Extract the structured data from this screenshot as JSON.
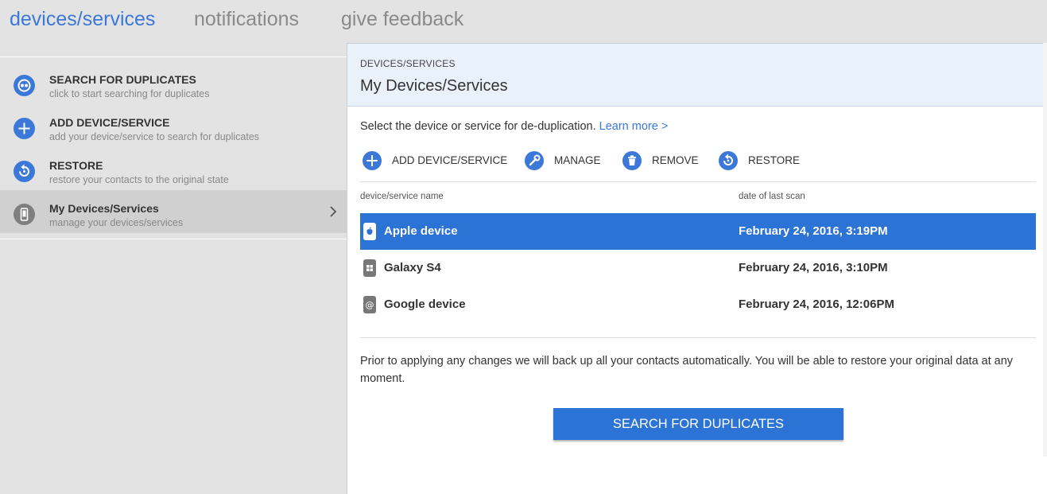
{
  "topnav": {
    "tabs": [
      {
        "label": "devices/services",
        "active": true
      },
      {
        "label": "notifications",
        "active": false
      },
      {
        "label": "give feedback",
        "active": false
      }
    ]
  },
  "sidebar": {
    "items": [
      {
        "title": "SEARCH FOR DUPLICATES",
        "subtitle": "click to start searching for duplicates",
        "icon": "search-duplicates-icon"
      },
      {
        "title": "ADD DEVICE/SERVICE",
        "subtitle": "add your device/service to search for duplicates",
        "icon": "plus-icon"
      },
      {
        "title": "RESTORE",
        "subtitle": "restore your contacts to the original state",
        "icon": "restore-icon"
      },
      {
        "title": "My Devices/Services",
        "subtitle": "manage your devices/services",
        "icon": "phone-icon",
        "active": true
      }
    ]
  },
  "main": {
    "breadcrumb": "DEVICES/SERVICES",
    "title": "My Devices/Services",
    "intro_text": "Select the device or service for de-duplication.",
    "learn_more": "Learn more >",
    "toolbar": {
      "add": "ADD DEVICE/SERVICE",
      "manage": "MANAGE",
      "remove": "REMOVE",
      "restore": "RESTORE"
    },
    "table": {
      "columns": [
        "device/service name",
        "date of last scan"
      ],
      "rows": [
        {
          "name": "Apple device",
          "date": "February 24, 2016, 3:19PM",
          "icon": "apple-icon",
          "selected": true
        },
        {
          "name": "Galaxy S4",
          "date": "February 24, 2016, 3:10PM",
          "icon": "windows-icon",
          "selected": false
        },
        {
          "name": "Google device",
          "date": "February 24, 2016, 12:06PM",
          "icon": "at-sign-icon",
          "selected": false
        }
      ]
    },
    "note": "Prior to applying any changes we will back up all your contacts automatically. You will be able to restore your original data at any moment.",
    "primary_button": "SEARCH FOR DUPLICATES"
  },
  "colors": {
    "accent": "#3c78d8",
    "selected_row": "#2c73d6",
    "header_bg": "#e9f1fb",
    "page_bg": "#e3e3e3"
  }
}
